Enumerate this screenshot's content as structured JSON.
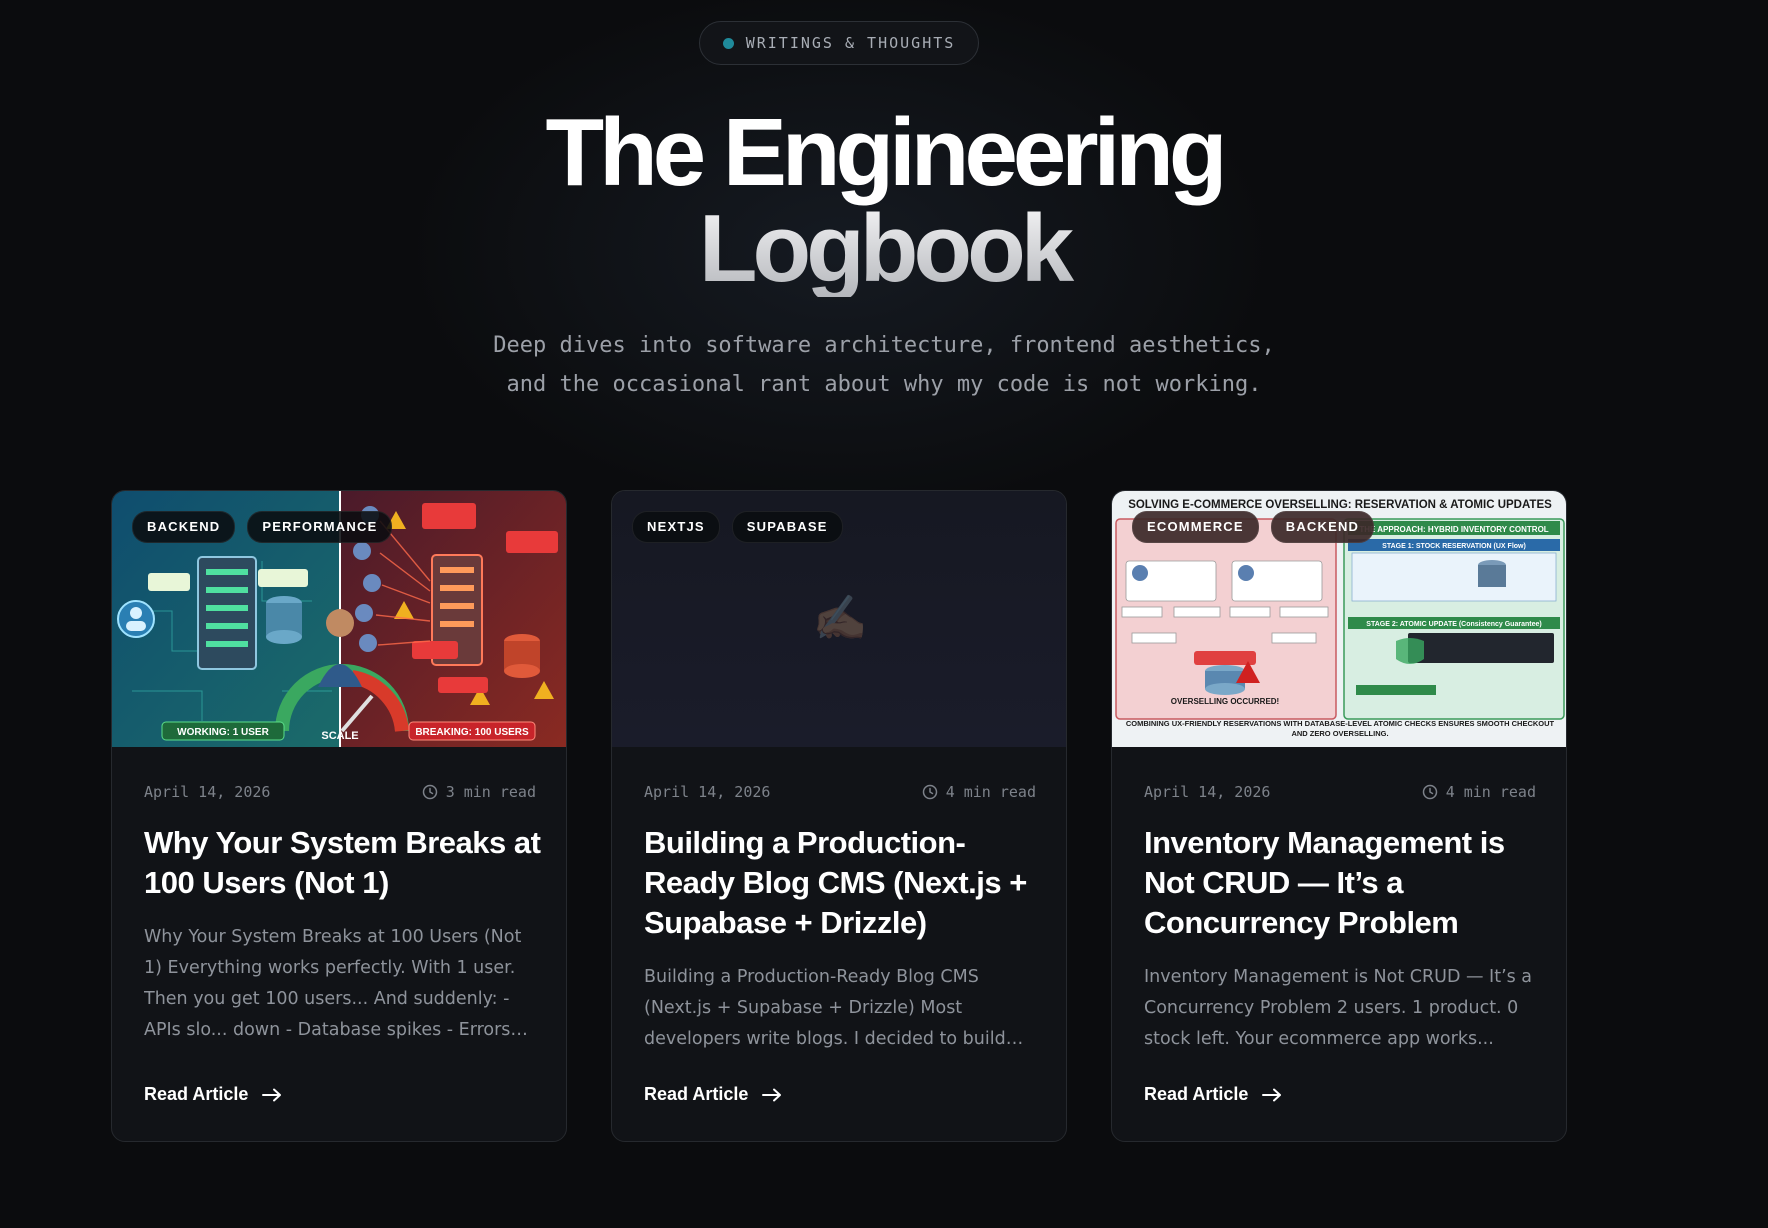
{
  "hero": {
    "badge": "WRITINGS & THOUGHTS",
    "title_line1": "The Engineering",
    "title_line2": "Logbook",
    "subtitle_line1": "Deep dives into software architecture, frontend aesthetics,",
    "subtitle_line2": "and the occasional rant about why my code is not working."
  },
  "cards": [
    {
      "tags": [
        "BACKEND",
        "PERFORMANCE"
      ],
      "date": "April 14, 2026",
      "read_time": "3 min read",
      "title": "Why Your System Breaks at 100 Users (Not 1)",
      "excerpt": "Why Your System Breaks at 100 Users (Not 1) Everything works perfectly. With 1 user. Then you get 100 users... And suddenly: - APIs slo... down - Database spikes - Errors appe...",
      "link": "Read Article",
      "thumb": {
        "left_label": "WORKING: 1 USER",
        "center_label": "SCALE",
        "right_label": "BREAKING: 100 USERS"
      }
    },
    {
      "tags": [
        "NEXTJS",
        "SUPABASE"
      ],
      "date": "April 14, 2026",
      "read_time": "4 min read",
      "title": "Building a Production-Ready Blog CMS (Next.js + Supabase + Drizzle)",
      "excerpt": "Building a Production-Ready Blog CMS (Next.js + Supabase + Drizzle) Most developers write blogs. I decided to build th...",
      "link": "Read Article",
      "thumb": {
        "emoji": "✍🏽"
      }
    },
    {
      "tags": [
        "ECOMMERCE",
        "BACKEND"
      ],
      "date": "April 14, 2026",
      "read_time": "4 min read",
      "title": "Inventory Management is Not CRUD — It’s a Concurrency Problem",
      "excerpt": "Inventory Management is Not CRUD — It’s a Concurrency Problem 2 users. 1 product. 0 stock left. Your ecommerce app works...",
      "link": "Read Article",
      "thumb": {
        "heading": "SOLVING E-COMMERCE OVERSELLING: RESERVATION & ATOMIC UPDATES",
        "approach": "THE APPROACH: HYBRID INVENTORY CONTROL",
        "stage1": "STAGE 1: STOCK RESERVATION (UX Flow)",
        "stage2": "STAGE 2: ATOMIC UPDATE (Consistency Guarantee)",
        "oversell": "OVERSELLING OCCURRED!",
        "footer": "COMBINING UX-FRIENDLY RESERVATIONS WITH DATABASE-LEVEL ATOMIC CHECKS ENSURES SMOOTH CHECKOUT AND ZERO OVERSELLING."
      }
    }
  ],
  "colors": {
    "background": "#0b0c0e",
    "card": "#111317",
    "accent_dot": "#1f8a9a"
  },
  "icons": {
    "read_time": "clock-icon",
    "link": "arrow-right-icon"
  }
}
